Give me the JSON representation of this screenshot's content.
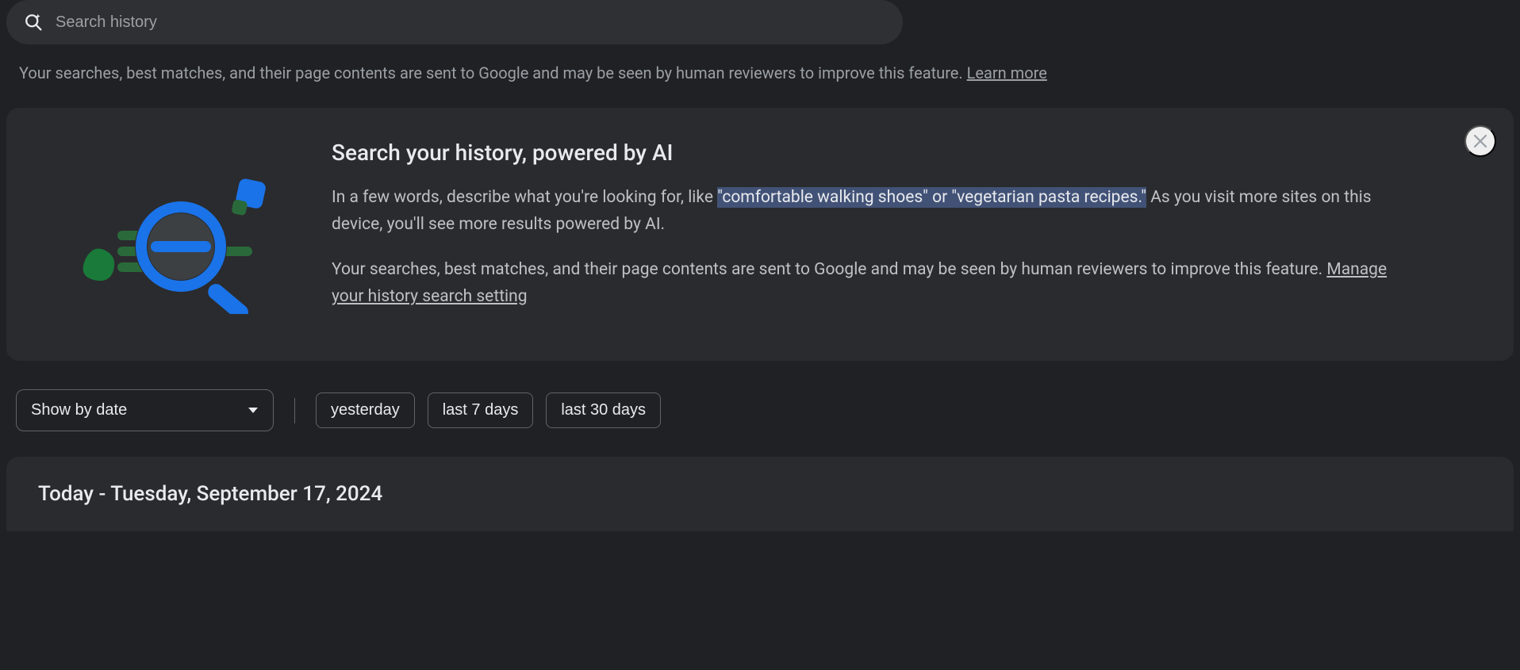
{
  "search": {
    "placeholder": "Search history"
  },
  "disclaimer": {
    "text": "Your searches, best matches, and their page contents are sent to Google and may be seen by human reviewers to improve this feature. ",
    "link": "Learn more"
  },
  "ai_card": {
    "title": "Search your history, powered by AI",
    "para1_a": "In a few words, describe what you're looking for, like ",
    "para1_highlight": "\"comfortable walking shoes\" or \"vegetarian pasta recipes.\"",
    "para1_b": " As you visit more sites on this device, you'll see more results powered by AI.",
    "para2_a": "Your searches, best matches, and their page contents are sent to Google and may be seen by human reviewers to improve this feature. ",
    "para2_link": "Manage your history search setting"
  },
  "filters": {
    "show_by_date": "Show by date",
    "chips": {
      "yesterday": "yesterday",
      "last7": "last 7 days",
      "last30": "last 30 days"
    }
  },
  "sections": {
    "today": "Today - Tuesday, September 17, 2024"
  }
}
